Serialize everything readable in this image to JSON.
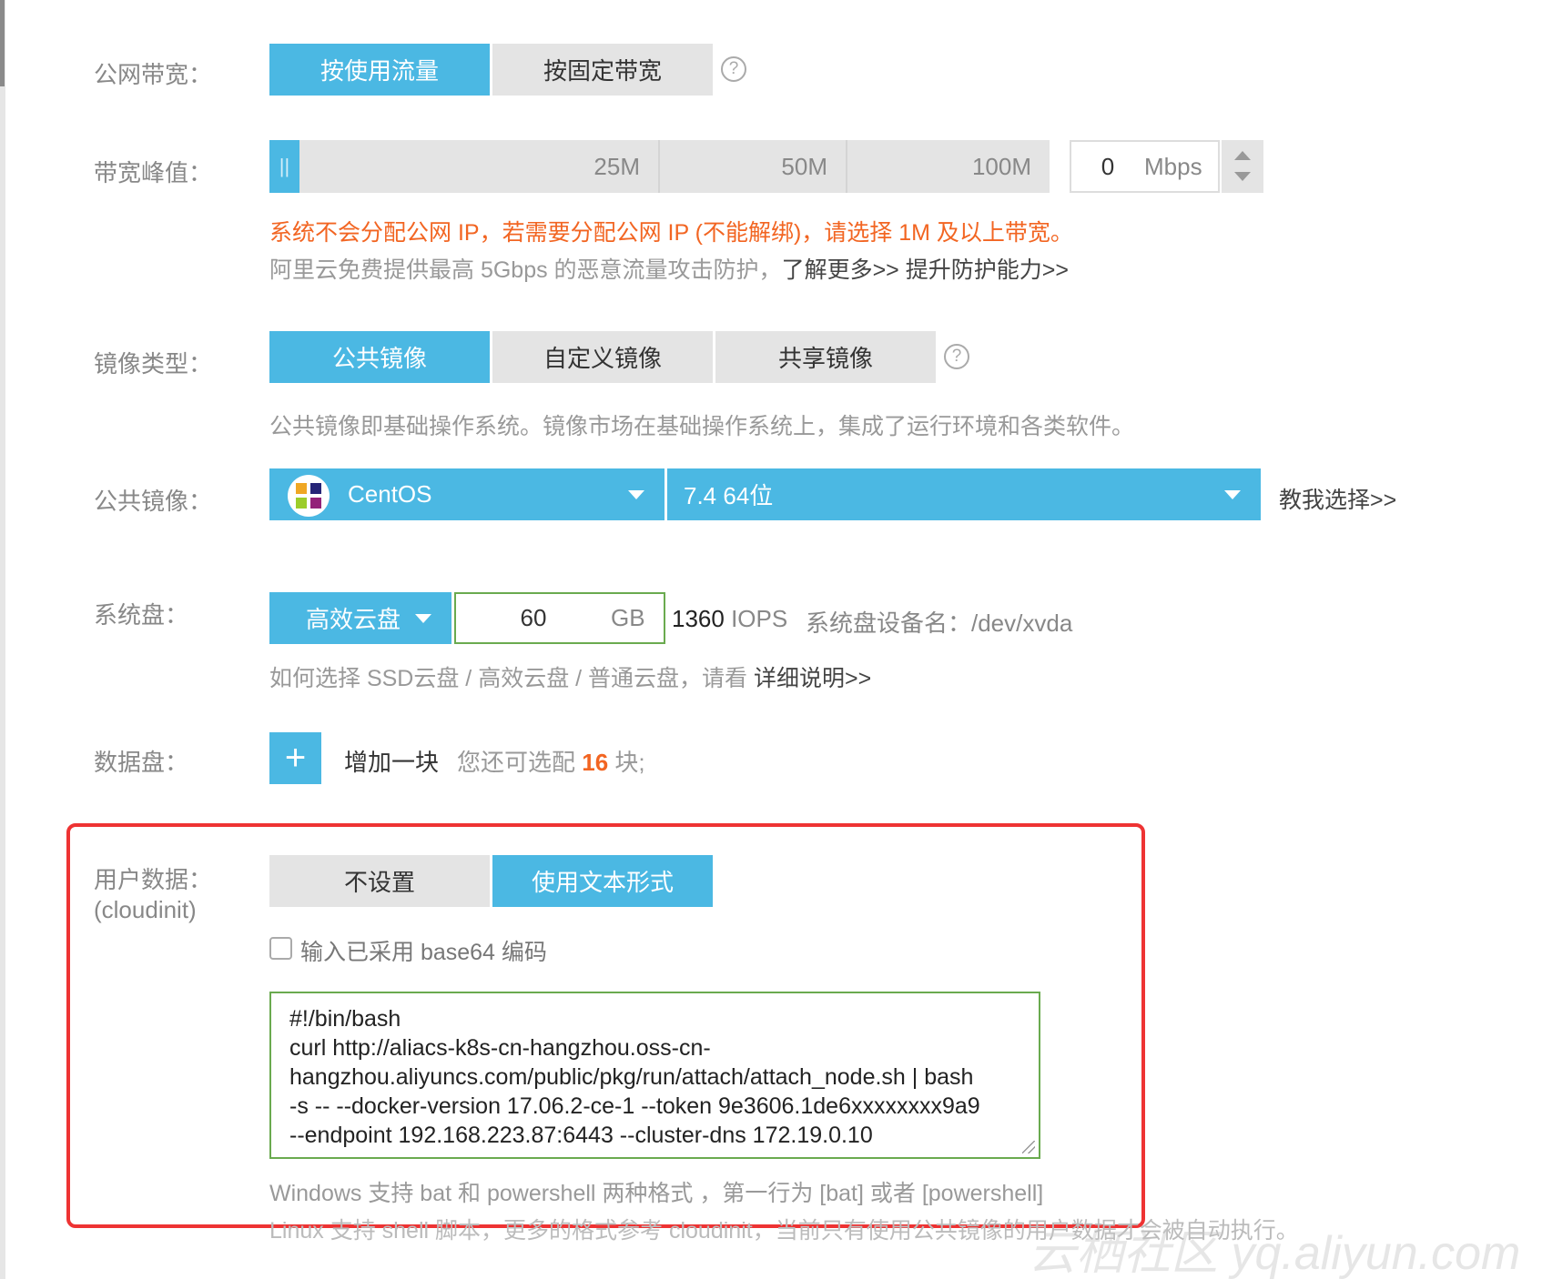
{
  "bandwidth": {
    "label": "公网带宽：",
    "options": [
      {
        "label": "按使用流量",
        "active": true
      },
      {
        "label": "按固定带宽",
        "active": false
      }
    ],
    "help": "?"
  },
  "peak": {
    "label": "带宽峰值：",
    "ticks": [
      "25M",
      "50M",
      "100M"
    ],
    "value": "0",
    "unit": "Mbps",
    "warning": "系统不会分配公网 IP，若需要分配公网 IP (不能解绑)，请选择 1M 及以上带宽。",
    "ddos_text": "阿里云免费提供最高 5Gbps 的恶意流量攻击防护，",
    "learn_more": "了解更多>>",
    "upgrade": "提升防护能力>>"
  },
  "image_type": {
    "label": "镜像类型：",
    "options": [
      {
        "label": "公共镜像",
        "active": true
      },
      {
        "label": "自定义镜像",
        "active": false
      },
      {
        "label": "共享镜像",
        "active": false
      }
    ],
    "help": "?",
    "description": "公共镜像即基础操作系统。镜像市场在基础操作系统上，集成了运行环境和各类软件。"
  },
  "public_image": {
    "label": "公共镜像：",
    "os": "CentOS",
    "version": "7.4 64位",
    "help_link": "教我选择>>"
  },
  "system_disk": {
    "label": "系统盘：",
    "type": "高效云盘",
    "size": "60",
    "unit": "GB",
    "iops_value": "1360",
    "iops_unit": "IOPS",
    "device": "系统盘设备名：/dev/xvda",
    "help_text": "如何选择 SSD云盘 / 高效云盘 / 普通云盘，请看",
    "help_link": "详细说明>>"
  },
  "data_disk": {
    "label": "数据盘：",
    "add_label": "增加一块",
    "remaining_prefix": "您还可选配",
    "remaining_count": "16",
    "remaining_suffix": "块;"
  },
  "user_data": {
    "label": "用户数据：",
    "sublabel": "(cloudinit)",
    "options": [
      {
        "label": "不设置",
        "active": false
      },
      {
        "label": "使用文本形式",
        "active": true
      }
    ],
    "base64_label": "输入已采用 base64 编码",
    "script_lines": [
      "#!/bin/bash",
      "curl http://aliacs-k8s-cn-hangzhou.oss-cn-",
      "hangzhou.aliyuncs.com/public/pkg/run/attach/attach_node.sh | bash",
      "-s -- --docker-version 17.06.2-ce-1 --token 9e3606.1de6xxxxxxxx9a9",
      "--endpoint 192.168.223.87:6443 --cluster-dns 172.19.0.10"
    ],
    "windows_note": "Windows 支持 bat 和 powershell 两种格式 ，第一行为 [bat] 或者 [powershell]",
    "linux_note": "Linux 支持 shell 脚本，更多的格式参考 cloudinit，当前只有使用公共镜像的用户数据才会被自动执行。"
  },
  "watermark": "云栖社区 yq.aliyun.com",
  "colors": {
    "accent": "#4bb8e3",
    "warning": "#f26522",
    "highlight_box": "#e33333",
    "field_border": "#6aaa4f"
  }
}
